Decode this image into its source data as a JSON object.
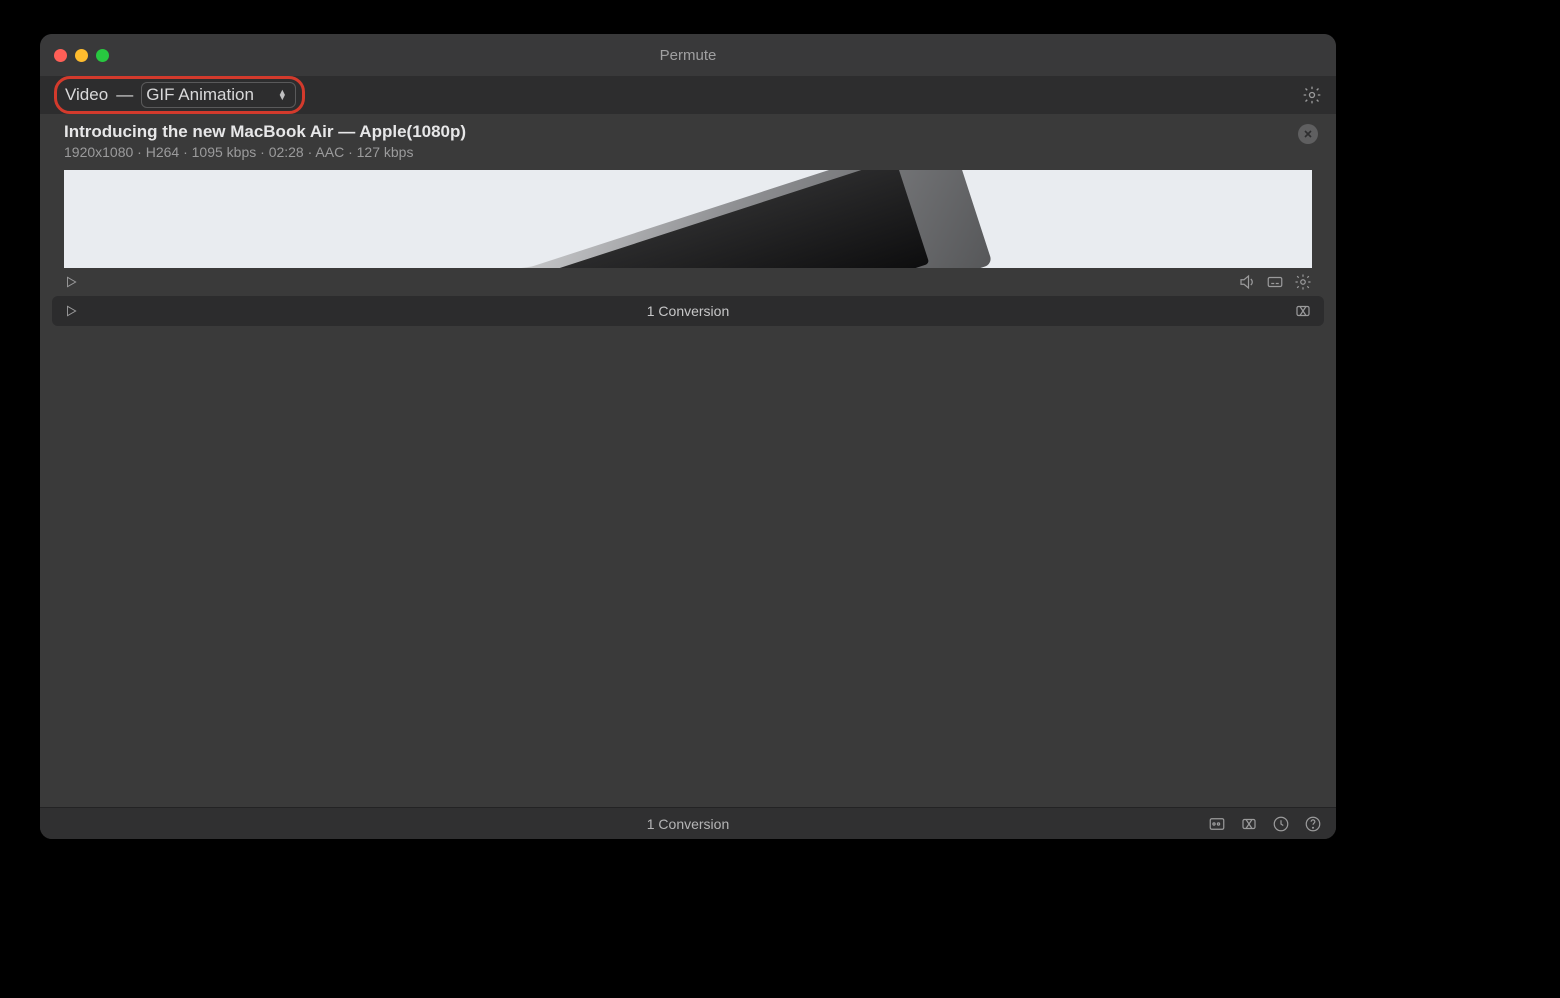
{
  "window": {
    "title": "Permute"
  },
  "toolbar": {
    "category_label": "Video",
    "separator": "—",
    "preset_selected": "GIF Animation"
  },
  "item": {
    "title": "Introducing the new MacBook Air — Apple(1080p)",
    "meta": "1920x1080 · H264 · 1095 kbps · 02:28 · AAC · 127 kbps"
  },
  "queue": {
    "label": "1 Conversion"
  },
  "status": {
    "label": "1 Conversion"
  },
  "icons": {
    "gear": "gear-icon",
    "close": "close-icon",
    "play": "play-icon",
    "volume": "volume-icon",
    "subtitles": "subtitles-icon",
    "item_gear": "gear-icon",
    "queue_clear": "clear-queue-icon",
    "status_presets": "presets-icon",
    "status_queue": "queue-icon",
    "status_history": "history-icon",
    "status_help": "help-icon"
  }
}
